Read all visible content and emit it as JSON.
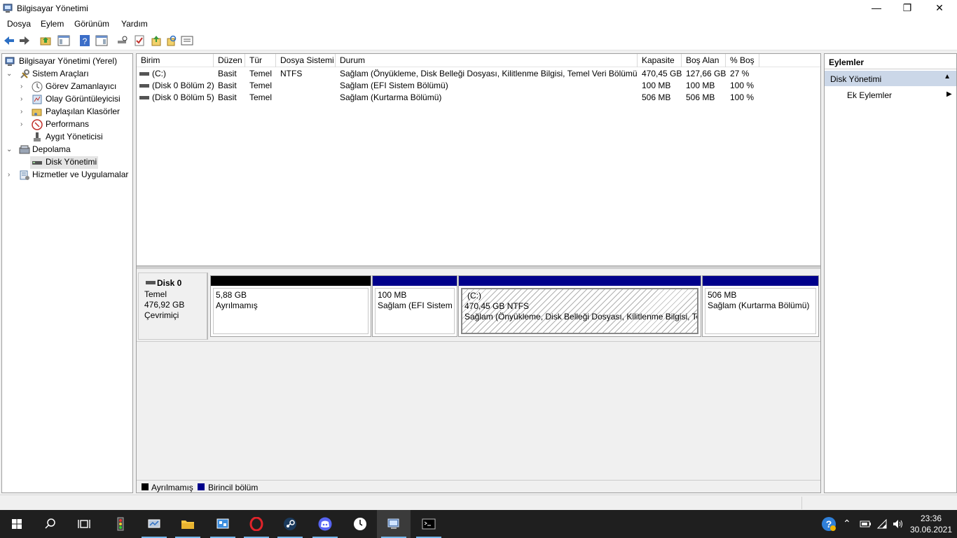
{
  "window": {
    "title": "Bilgisayar Yönetimi",
    "minimize": "—",
    "maximize": "❐",
    "close": "✕"
  },
  "menu": [
    "Dosya",
    "Eylem",
    "Görünüm",
    "Yardım"
  ],
  "tree": {
    "root": "Bilgisayar Yönetimi (Yerel)",
    "system_tools": "Sistem Araçları",
    "task_scheduler": "Görev Zamanlayıcı",
    "event_viewer": "Olay Görüntüleyicisi",
    "shared_folders": "Paylaşılan Klasörler",
    "performance": "Performans",
    "device_manager": "Aygıt Yöneticisi",
    "storage": "Depolama",
    "disk_management": "Disk Yönetimi",
    "services_apps": "Hizmetler ve Uygulamalar"
  },
  "volumes": {
    "headers": [
      "Birim",
      "Düzen",
      "Tür",
      "Dosya Sistemi",
      "Durum",
      "Kapasite",
      "Boş Alan",
      "% Boş"
    ],
    "rows": [
      [
        "(C:)",
        "Basit",
        "Temel",
        "NTFS",
        "Sağlam (Önyükleme, Disk Belleği Dosyası, Kilitlenme Bilgisi, Temel Veri Bölümü)",
        "470,45 GB",
        "127,66 GB",
        "27 %"
      ],
      [
        "(Disk 0 Bölüm 2)",
        "Basit",
        "Temel",
        "",
        "Sağlam (EFI Sistem Bölümü)",
        "100 MB",
        "100 MB",
        "100 %"
      ],
      [
        "(Disk 0 Bölüm 5)",
        "Basit",
        "Temel",
        "",
        "Sağlam (Kurtarma Bölümü)",
        "506 MB",
        "506 MB",
        "100 %"
      ]
    ]
  },
  "disk": {
    "name": "Disk 0",
    "type": "Temel",
    "size": "476,92 GB",
    "status": "Çevrimiçi",
    "partitions": [
      {
        "line0": "",
        "line1": "5,88 GB",
        "line2": "Ayrılmamış",
        "kind": "unallocated"
      },
      {
        "line0": "",
        "line1": "100 MB",
        "line2": "Sağlam (EFI Sistem B",
        "kind": "primary"
      },
      {
        "line0": "(C:)",
        "line1": "470,45 GB NTFS",
        "line2": "Sağlam (Önyükleme, Disk Belleği Dosyası, Kilitlenme Bilgisi, Ter",
        "kind": "primary-selected"
      },
      {
        "line0": "",
        "line1": "506 MB",
        "line2": "Sağlam (Kurtarma Bölümü)",
        "kind": "primary"
      }
    ]
  },
  "legend": {
    "unallocated": "Ayrılmamış",
    "primary": "Birincil bölüm"
  },
  "actions": {
    "title": "Eylemler",
    "section": "Disk Yönetimi",
    "more": "Ek Eylemler"
  },
  "colors": {
    "primary": "#00008b",
    "unallocated": "#000000",
    "selection": "#cbd7e8"
  },
  "clock": {
    "time": "23:36",
    "date": "30.06.2021"
  }
}
